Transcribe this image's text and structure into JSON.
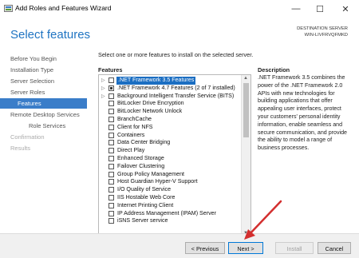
{
  "window": {
    "title": "Add Roles and Features Wizard",
    "minimize_glyph": "—",
    "maximize_glyph": "☐",
    "close_glyph": "✕"
  },
  "header": {
    "page_title": "Select features",
    "destination_label": "DESTINATION SERVER",
    "destination_server": "WIN-LIVFRVQFMKD"
  },
  "sidebar": {
    "items": [
      {
        "label": "Before You Begin",
        "state": "normal"
      },
      {
        "label": "Installation Type",
        "state": "normal"
      },
      {
        "label": "Server Selection",
        "state": "normal"
      },
      {
        "label": "Server Roles",
        "state": "normal"
      },
      {
        "label": "Features",
        "state": "active"
      },
      {
        "label": "Remote Desktop Services",
        "state": "normal"
      },
      {
        "label": "Role Services",
        "state": "sub"
      },
      {
        "label": "Confirmation",
        "state": "disabled"
      },
      {
        "label": "Results",
        "state": "disabled"
      }
    ]
  },
  "content": {
    "intro": "Select one or more features to install on the selected server.",
    "features_header": "Features",
    "description_header": "Description",
    "description": ".NET Framework 3.5 combines the power of the .NET Framework 2.0 APIs with new technologies for building applications that offer appealing user interfaces, protect your customers' personal identity information, enable seamless and secure communication, and provide the ability to model a range of business processes."
  },
  "features": [
    {
      "label": ".NET Framework 3.5 Features",
      "expandable": true,
      "checked": "none",
      "selected": true
    },
    {
      "label": ".NET Framework 4.7 Features (2 of 7 installed)",
      "expandable": true,
      "checked": "partial",
      "selected": false
    },
    {
      "label": "Background Intelligent Transfer Service (BITS)",
      "expandable": true,
      "checked": "none",
      "selected": false
    },
    {
      "label": "BitLocker Drive Encryption",
      "expandable": false,
      "checked": "none",
      "selected": false
    },
    {
      "label": "BitLocker Network Unlock",
      "expandable": false,
      "checked": "none",
      "selected": false
    },
    {
      "label": "BranchCache",
      "expandable": false,
      "checked": "none",
      "selected": false
    },
    {
      "label": "Client for NFS",
      "expandable": false,
      "checked": "none",
      "selected": false
    },
    {
      "label": "Containers",
      "expandable": false,
      "checked": "none",
      "selected": false
    },
    {
      "label": "Data Center Bridging",
      "expandable": false,
      "checked": "none",
      "selected": false
    },
    {
      "label": "Direct Play",
      "expandable": false,
      "checked": "none",
      "selected": false
    },
    {
      "label": "Enhanced Storage",
      "expandable": false,
      "checked": "none",
      "selected": false
    },
    {
      "label": "Failover Clustering",
      "expandable": false,
      "checked": "none",
      "selected": false
    },
    {
      "label": "Group Policy Management",
      "expandable": false,
      "checked": "none",
      "selected": false
    },
    {
      "label": "Host Guardian Hyper-V Support",
      "expandable": false,
      "checked": "none",
      "selected": false
    },
    {
      "label": "I/O Quality of Service",
      "expandable": false,
      "checked": "none",
      "selected": false
    },
    {
      "label": "IIS Hostable Web Core",
      "expandable": false,
      "checked": "none",
      "selected": false
    },
    {
      "label": "Internet Printing Client",
      "expandable": false,
      "checked": "none",
      "selected": false
    },
    {
      "label": "IP Address Management (IPAM) Server",
      "expandable": false,
      "checked": "none",
      "selected": false
    },
    {
      "label": "iSNS Server service",
      "expandable": false,
      "checked": "none",
      "selected": false
    }
  ],
  "buttons": {
    "previous": "< Previous",
    "next": "Next >",
    "install": "Install",
    "cancel": "Cancel"
  },
  "colors": {
    "accent": "#1f74c2",
    "active_nav": "#3a7dc9",
    "selection": "#1b6ec2",
    "arrow": "#d32f2f"
  }
}
